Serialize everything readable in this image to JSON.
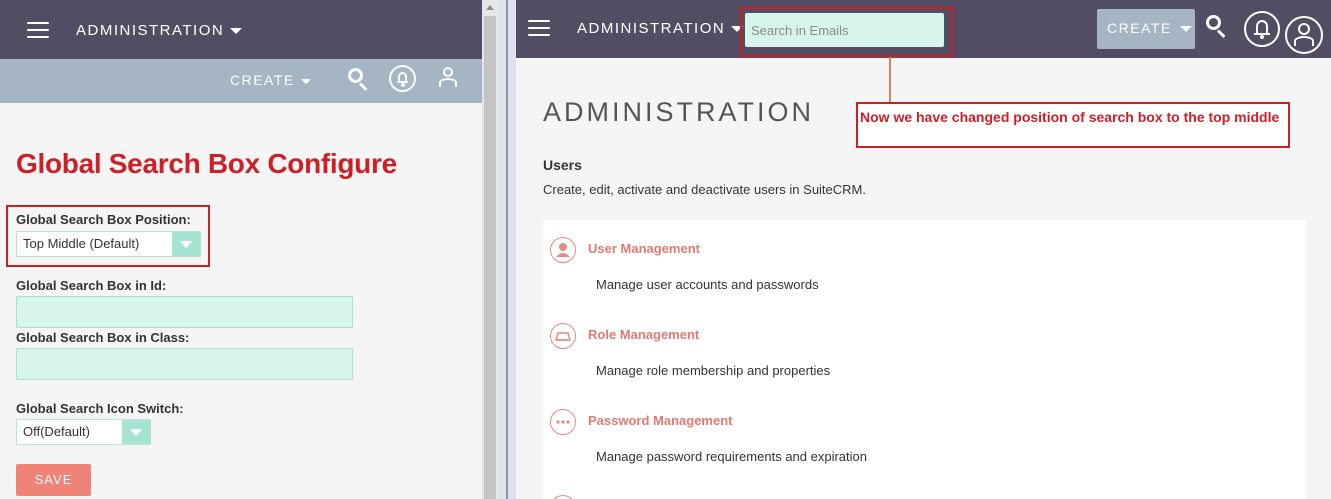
{
  "left_pane": {
    "nav": {
      "title": "ADMINISTRATION"
    },
    "subnav": {
      "create_label": "CREATE"
    },
    "page_title": "Global Search Box Configure",
    "fields": {
      "position_label": "Global Search Box Position:",
      "position_value": "Top Middle (Default)",
      "id_label": "Global Search Box in Id:",
      "id_value": "",
      "class_label": "Global Search Box in Class:",
      "class_value": "",
      "icon_switch_label": "Global Search Icon Switch:",
      "icon_switch_value": "Off(Default)"
    },
    "save_label": "SAVE"
  },
  "right_pane": {
    "nav": {
      "title": "ADMINISTRATION",
      "search_placeholder": "Search in Emails",
      "create_label": "CREATE"
    },
    "heading": "ADMINISTRATION",
    "section": {
      "title": "Users",
      "description": "Create, edit, activate and deactivate users in SuiteCRM."
    },
    "items": [
      {
        "title": "User Management",
        "description": "Manage user accounts and passwords",
        "icon": "user-icon"
      },
      {
        "title": "Role Management",
        "description": "Manage role membership and properties",
        "icon": "role-icon"
      },
      {
        "title": "Password Management",
        "description": "Manage password requirements and expiration",
        "icon": "password-icon"
      }
    ]
  },
  "annotation": {
    "text": "Now we have changed position of search box to the top middle"
  },
  "colors": {
    "topbar": "#534d64",
    "subbar": "#a5b5c3",
    "heading_red": "#cc1f26",
    "accent_mint": "#d8f5ec",
    "save_button": "#f08377",
    "link_salmon": "#e07b70"
  }
}
